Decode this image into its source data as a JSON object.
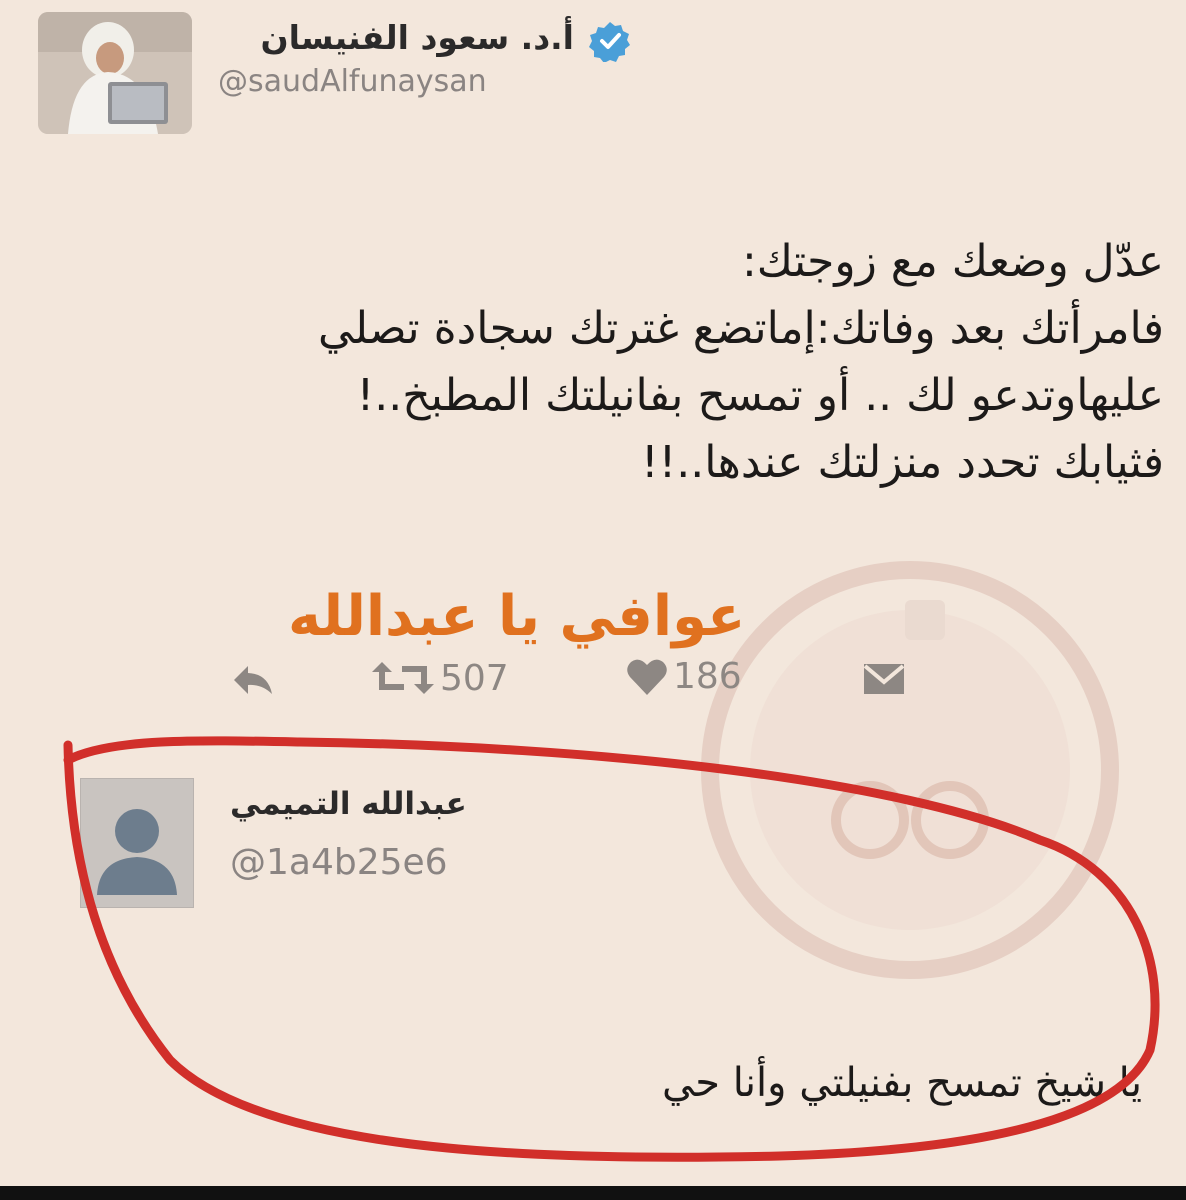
{
  "tweet": {
    "author_name": "أ.د. سعود الفنيسان",
    "author_handle": "@saudAlfunaysan",
    "lines": [
      "عدّل وضعك مع زوجتك:",
      "فامرأتك بعد وفاتك:إماتضع غترتك سجادة تصلي",
      "عليهاوتدعو لك ..        أو تمسح بفانيلتك المطبخ..!",
      "فثيابك تحدد منزلتك عندها..!!"
    ],
    "overlay_caption": "عوافي يا عبدالله",
    "retweet_count": "507",
    "like_count": "186"
  },
  "reply": {
    "author_name": "عبدالله التميمي",
    "author_handle": "@1a4b25e6",
    "text": "يا شيخ تمسح بفنيلتي وأنا حي"
  },
  "colors": {
    "background": "#f3e7dc",
    "verified": "#4a9fd8",
    "caption": "#e0711f",
    "annotation_circle": "#d12f2a"
  },
  "icons": {
    "verified": "verified-badge-icon",
    "reply": "reply-arrow-icon",
    "retweet": "retweet-icon",
    "like": "heart-icon",
    "mail": "envelope-icon",
    "default_avatar": "default-user-icon"
  }
}
